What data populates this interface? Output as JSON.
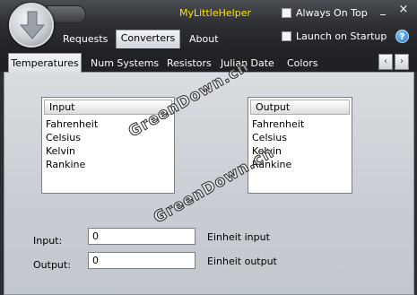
{
  "app": {
    "title": "MyLittleHelper"
  },
  "header": {
    "always_on_top": "Always On Top",
    "launch_on_startup": "Launch on Startup",
    "minimize": "_",
    "close": "×",
    "help": "?"
  },
  "main_tabs": [
    {
      "label": "Requests",
      "active": false
    },
    {
      "label": "Converters",
      "active": true
    },
    {
      "label": "About",
      "active": false
    }
  ],
  "sub_tabs": [
    {
      "label": "Temperatures",
      "active": true
    },
    {
      "label": "Num Systems",
      "active": false
    },
    {
      "label": "Resistors",
      "active": false
    },
    {
      "label": "Julian Date",
      "active": false
    },
    {
      "label": "Colors",
      "active": false
    }
  ],
  "nav_arrows": {
    "left": "‹",
    "right": "›"
  },
  "input_list": {
    "header": "Input",
    "items": [
      "Fahrenheit",
      "Celsius",
      "Kelvin",
      "Rankine"
    ]
  },
  "output_list": {
    "header": "Output",
    "items": [
      "Fahrenheit",
      "Celsius",
      "Kelvin",
      "Rankine"
    ]
  },
  "form": {
    "input_label": "Input:",
    "input_value": "0",
    "input_unit": "Einheit input",
    "output_label": "Output:",
    "output_value": "0",
    "output_unit": "Einheit output"
  },
  "watermark": {
    "text": "GreenDown.cn"
  },
  "colors": {
    "title": "#ffe400",
    "header_bg": "#2e3034",
    "panel_bg": "#d9dde2"
  }
}
